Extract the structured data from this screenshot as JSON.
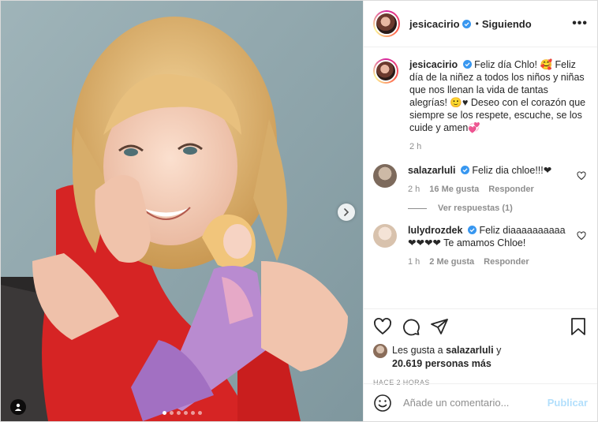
{
  "post": {
    "author": "jesicacirio",
    "follow_status": "Siguiendo",
    "separator": "•",
    "more_label": "•••",
    "caption_author": "jesicacirio",
    "caption_text": "Feliz día Chlo! 🥰 Feliz día de la niñez a todos los niños y niñas que nos llenan la vida de tantas alegrías! 🙂♥ Deseo con el corazón que siempre se los respete, escuche, se los cuide y amen💞",
    "caption_time": "2 h"
  },
  "comments": [
    {
      "user": "salazarluli",
      "text": "Feliz dia chloe!!!❤",
      "time": "2 h",
      "likes": "16 Me gusta",
      "reply_label": "Responder",
      "replies_label": "Ver respuestas (1)"
    },
    {
      "user": "lulydrozdek",
      "text": "Feliz diaaaaaaaaaa ❤❤❤❤ Te amamos Chloe!",
      "time": "1 h",
      "likes": "2 Me gusta",
      "reply_label": "Responder"
    }
  ],
  "likes_summary": {
    "prefix": "Les gusta a",
    "user": "salazarluli",
    "joiner": "y",
    "count": "20.619 personas más"
  },
  "timestamp": "HACE 2 HORAS",
  "comment_box": {
    "placeholder": "Añade un comentario...",
    "publish_label": "Publicar"
  },
  "carousel": {
    "total": 6,
    "active_index": 0
  },
  "colors": {
    "verified": "#3897f0",
    "heart": "#ed1d3c",
    "publish_disabled": "#b2dffc",
    "muted_text": "#8e8e8e"
  },
  "icons": [
    "like-icon",
    "comment-icon",
    "share-icon",
    "save-icon",
    "emoji-icon",
    "next-icon",
    "user-tag-icon",
    "verified-icon",
    "heart-icon"
  ]
}
